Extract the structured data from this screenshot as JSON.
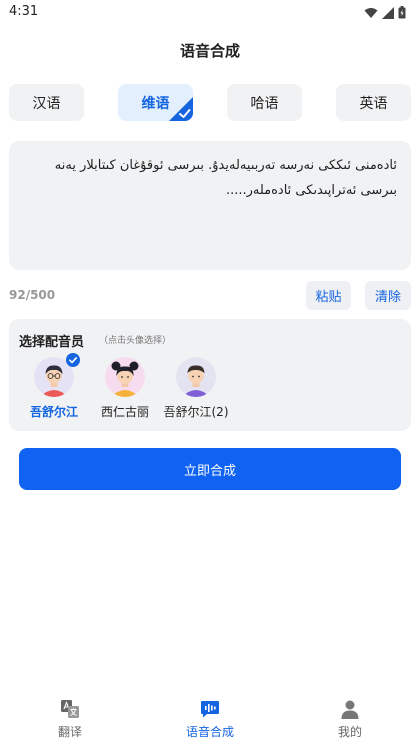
{
  "status_bar": {
    "time": "4:31"
  },
  "header": {
    "title": "语音合成"
  },
  "languages": [
    {
      "label": "汉语",
      "active": false
    },
    {
      "label": "维语",
      "active": true
    },
    {
      "label": "哈语",
      "active": false
    },
    {
      "label": "英语",
      "active": false
    }
  ],
  "input": {
    "text": "ئادەمنى ئىككى نەرسە تەربىيەلەيدۇ. بىرسى ئوقۇغان كىتابلار يەنە بىرسى ئەتراپىدىكى ئادەملەر....."
  },
  "counter": {
    "text": "92/500"
  },
  "actions": {
    "paste_label": "粘贴",
    "clear_label": "清除"
  },
  "voices": {
    "title": "选择配音员",
    "hint": "（点击头像选择）",
    "items": [
      {
        "name": "吾舒尔江",
        "selected": true,
        "avatar": "man-glasses-avatar"
      },
      {
        "name": "西仁古丽",
        "selected": false,
        "avatar": "woman-buns-avatar"
      },
      {
        "name": "吾舒尔江(2)",
        "selected": false,
        "avatar": "man-avatar"
      }
    ]
  },
  "synthesize": {
    "label": "立即合成"
  },
  "bottom_nav": [
    {
      "label": "翻译",
      "icon": "translate-icon",
      "active": false
    },
    {
      "label": "语音合成",
      "icon": "voice-synthesis-icon",
      "active": true
    },
    {
      "label": "我的",
      "icon": "person-icon",
      "active": false
    }
  ],
  "colors": {
    "accent": "#0f62f2",
    "active_text": "#1565e0",
    "panel_bg": "#f1f2f4"
  }
}
